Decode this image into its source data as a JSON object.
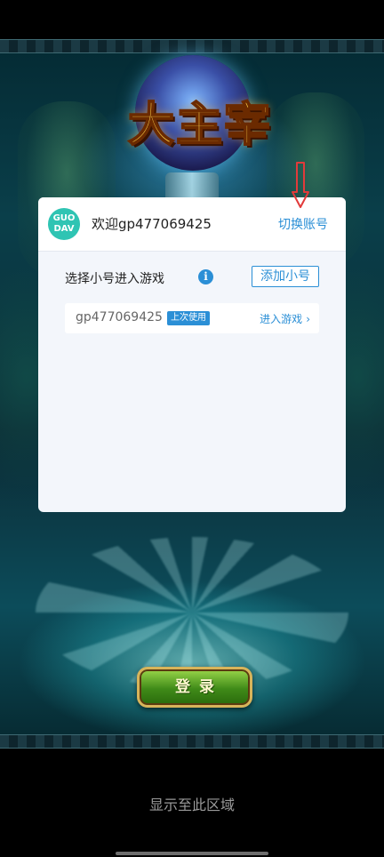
{
  "game": {
    "logo_title": "大主宰"
  },
  "dialog": {
    "app_logo_text": "GUO\nDAV",
    "welcome": "欢迎gp477069425",
    "switch_account": "切换账号",
    "section_title": "选择小号进入游戏",
    "info_icon_glyph": "i",
    "add_sub_account": "添加小号",
    "accounts": [
      {
        "name": "gp477069425",
        "badge": "上次使用",
        "action": "进入游戏",
        "chevron": "›"
      }
    ]
  },
  "login_button": "登录",
  "bottom_hint": "显示至此区域",
  "colors": {
    "accent": "#2b8fd6",
    "arrow": "#e23a3a",
    "login_green": "#3f8a18"
  }
}
